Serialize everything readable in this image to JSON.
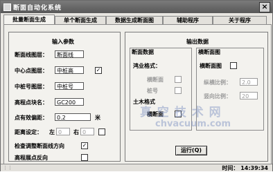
{
  "window": {
    "title": "断面自动化系统",
    "close": "×"
  },
  "tabs": [
    {
      "label": "批量断面生成"
    },
    {
      "label": "单个断面生成"
    },
    {
      "label": "数据生成断面图"
    },
    {
      "label": "辅助程序"
    },
    {
      "label": "关于程序"
    }
  ],
  "input_panel": {
    "title": "输入参数",
    "section_layer": {
      "label": "断面线图层：",
      "value": "断面线"
    },
    "center_point_layer": {
      "label": "中心点图层：",
      "value": "中桩高",
      "checked": "✓"
    },
    "chainage_layer": {
      "label": "中桩号图层：",
      "value": "中桩号"
    },
    "elevation_block": {
      "label": "高程点块名：",
      "value": "GC200"
    },
    "point_tolerance": {
      "label": "点有效偏距：",
      "value": "0.2",
      "unit": "米"
    },
    "distance_setting": {
      "label": "距离设定：",
      "left_label": "左",
      "left_value": "0",
      "right_label": "右",
      "right_value": "0"
    },
    "adjust_direction": {
      "label": "检查调整断面线方向",
      "checked": "✓"
    },
    "reverse_elevation": {
      "label": "高程展点反向"
    }
  },
  "output_panel": {
    "title": "输出数据",
    "section_data": {
      "title": "断面数据",
      "format_label": "鸿业格式：",
      "opt_horizontal": "横断面",
      "opt_chainage": "桩号",
      "opt_third": "土木格式",
      "opt_section_chart": "横断面"
    },
    "section_chart": {
      "title": "横断面图",
      "chart_label": "横断面图",
      "h_scale_label": "纵横比例：",
      "h_scale_value": "2.0",
      "v_scale_label": "竖向比例：",
      "v_scale_value": "20"
    },
    "run_button": "运行(Q)"
  },
  "watermark": {
    "line1": "真 空 技 术 网",
    "line2": "chvacuum.com"
  },
  "status": {
    "time": "时间： 14:39:34"
  }
}
